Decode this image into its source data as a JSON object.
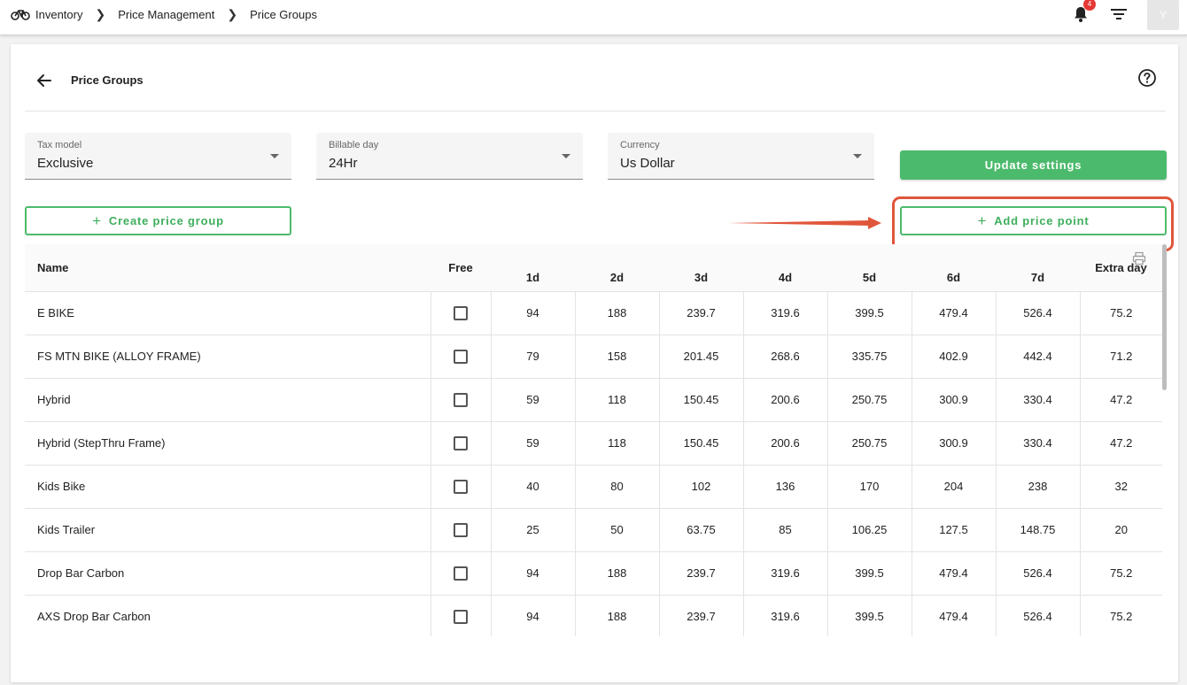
{
  "breadcrumbs": {
    "items": [
      "Inventory",
      "Price Management",
      "Price Groups"
    ]
  },
  "topbar": {
    "notifications_count": "4",
    "avatar_initial": "Y"
  },
  "page": {
    "title": "Price Groups"
  },
  "settings": {
    "tax_model": {
      "label": "Tax model",
      "value": "Exclusive"
    },
    "billable_day": {
      "label": "Billable day",
      "value": "24Hr"
    },
    "currency": {
      "label": "Currency",
      "value": "Us Dollar"
    },
    "update_label": "Update settings"
  },
  "actions": {
    "create_label": "Create price group",
    "add_label": "Add price point"
  },
  "table": {
    "headers": {
      "name": "Name",
      "free": "Free",
      "d1": "1d",
      "d2": "2d",
      "d3": "3d",
      "d4": "4d",
      "d5": "5d",
      "d6": "6d",
      "d7": "7d",
      "extra": "Extra day"
    },
    "rows": [
      {
        "name": "E BIKE",
        "d1": "94",
        "d2": "188",
        "d3": "239.7",
        "d4": "319.6",
        "d5": "399.5",
        "d6": "479.4",
        "d7": "526.4",
        "extra": "75.2"
      },
      {
        "name": "FS MTN BIKE (ALLOY FRAME)",
        "d1": "79",
        "d2": "158",
        "d3": "201.45",
        "d4": "268.6",
        "d5": "335.75",
        "d6": "402.9",
        "d7": "442.4",
        "extra": "71.2"
      },
      {
        "name": "Hybrid",
        "d1": "59",
        "d2": "118",
        "d3": "150.45",
        "d4": "200.6",
        "d5": "250.75",
        "d6": "300.9",
        "d7": "330.4",
        "extra": "47.2"
      },
      {
        "name": "Hybrid (StepThru Frame)",
        "d1": "59",
        "d2": "118",
        "d3": "150.45",
        "d4": "200.6",
        "d5": "250.75",
        "d6": "300.9",
        "d7": "330.4",
        "extra": "47.2"
      },
      {
        "name": "Kids Bike",
        "d1": "40",
        "d2": "80",
        "d3": "102",
        "d4": "136",
        "d5": "170",
        "d6": "204",
        "d7": "238",
        "extra": "32"
      },
      {
        "name": "Kids Trailer",
        "d1": "25",
        "d2": "50",
        "d3": "63.75",
        "d4": "85",
        "d5": "106.25",
        "d6": "127.5",
        "d7": "148.75",
        "extra": "20"
      },
      {
        "name": "Drop Bar Carbon",
        "d1": "94",
        "d2": "188",
        "d3": "239.7",
        "d4": "319.6",
        "d5": "399.5",
        "d6": "479.4",
        "d7": "526.4",
        "extra": "75.2"
      },
      {
        "name": "AXS Drop Bar Carbon",
        "d1": "94",
        "d2": "188",
        "d3": "239.7",
        "d4": "319.6",
        "d5": "399.5",
        "d6": "479.4",
        "d7": "526.4",
        "extra": "75.2"
      }
    ]
  },
  "colors": {
    "accent": "#4cba6c",
    "highlight": "#e0563b",
    "badge": "#e53935"
  }
}
